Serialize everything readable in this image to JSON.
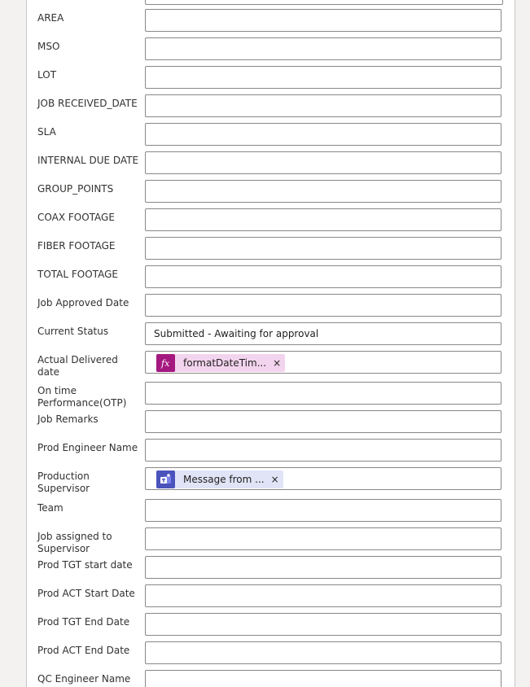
{
  "fields": [
    {
      "label": "AREA",
      "value": "",
      "token": null
    },
    {
      "label": "MSO",
      "value": "",
      "token": null
    },
    {
      "label": "LOT",
      "value": "",
      "token": null
    },
    {
      "label": "JOB RECEIVED_DATE",
      "value": "",
      "token": null
    },
    {
      "label": "SLA",
      "value": "",
      "token": null
    },
    {
      "label": "INTERNAL DUE DATE",
      "value": "",
      "token": null
    },
    {
      "label": "GROUP_POINTS",
      "value": "",
      "token": null
    },
    {
      "label": "COAX FOOTAGE",
      "value": "",
      "token": null
    },
    {
      "label": "FIBER FOOTAGE",
      "value": "",
      "token": null
    },
    {
      "label": "TOTAL FOOTAGE",
      "value": "",
      "token": null
    },
    {
      "label": "Job Approved Date",
      "value": "",
      "token": null
    },
    {
      "label": "Current Status",
      "value": "Submitted - Awaiting for approval",
      "token": null
    },
    {
      "label": "Actual Delivered date",
      "value": "",
      "token": {
        "kind": "expression",
        "icon": "fx-icon",
        "text": "formatDateTim...",
        "close": "×",
        "color": "#a4187f"
      }
    },
    {
      "label": "On time Performance(OTP)",
      "value": "",
      "token": null
    },
    {
      "label": "Job Remarks",
      "value": "",
      "token": null
    },
    {
      "label": "Prod Engineer Name",
      "value": "",
      "token": null
    },
    {
      "label": "Production Supervisor",
      "value": "",
      "token": {
        "kind": "teams",
        "icon": "teams-icon",
        "text": "Message from ...",
        "close": "×",
        "color": "#4b53bc"
      }
    },
    {
      "label": "Team",
      "value": "",
      "token": null
    },
    {
      "label": "Job assigned to Supervisor",
      "value": "",
      "token": null
    },
    {
      "label": "Prod TGT start date",
      "value": "",
      "token": null
    },
    {
      "label": "Prod ACT Start Date",
      "value": "",
      "token": null
    },
    {
      "label": "Prod TGT End Date",
      "value": "",
      "token": null
    },
    {
      "label": "Prod ACT End Date",
      "value": "",
      "token": null
    },
    {
      "label": "QC Engineer Name",
      "value": "",
      "token": null
    }
  ]
}
